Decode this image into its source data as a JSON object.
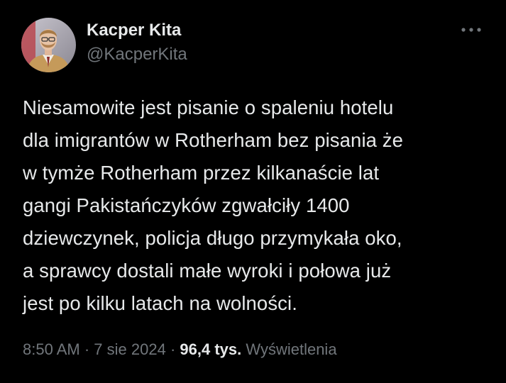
{
  "author": {
    "display_name": "Kacper Kita",
    "handle": "@KacperKita",
    "avatar_icon": "profile-photo"
  },
  "more_icon": "more-horizontal-icon",
  "tweet": {
    "text": "Niesamowite jest pisanie o spaleniu hotelu\ndla imigrantów w Rotherham bez pisania że\nw tymże Rotherham przez kilkanaście lat\ngangi Pakistańczyków zgwałciły 1400\ndziewczynek, policja długo przymykała oko,\na sprawcy dostali małe wyroki i połowa już\njest po kilku latach na wolności."
  },
  "meta": {
    "time": "8:50 AM",
    "separator": "·",
    "date": "7 sie 2024",
    "views_count": "96,4 tys.",
    "views_label": "Wyświetlenia"
  },
  "colors": {
    "background": "#000000",
    "primary_text": "#e7e9ea",
    "secondary_text": "#71767b"
  }
}
